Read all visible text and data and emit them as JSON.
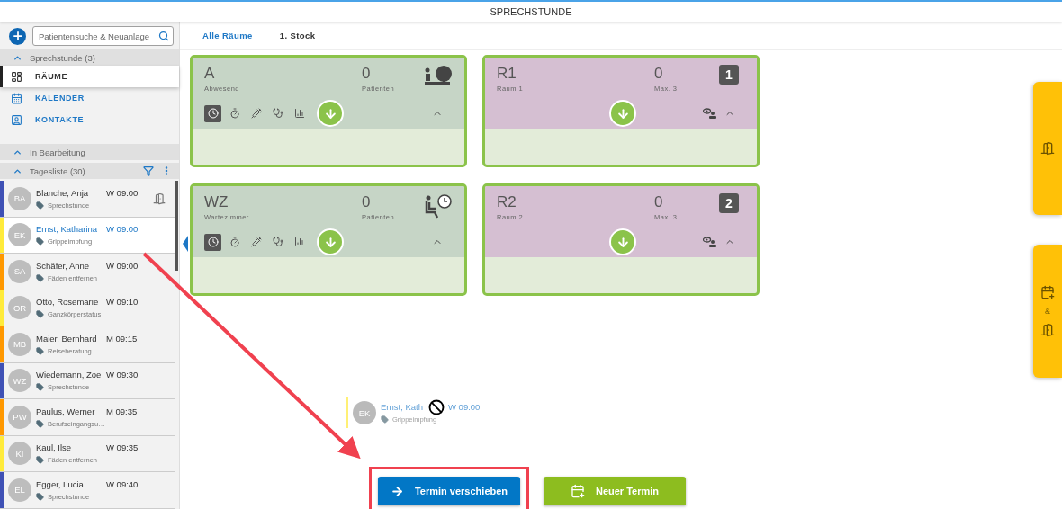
{
  "header": {
    "title": "SPRECHSTUNDE"
  },
  "sidebar": {
    "search": {
      "placeholder": "Patientensuche & Neuanlage"
    },
    "practice": {
      "title": "Sprechstunde (3)",
      "expanded": true,
      "items": [
        {
          "label": "RÄUME",
          "kind": "rooms",
          "selected": true
        },
        {
          "label": "KALENDER",
          "kind": "calendar",
          "selected": false
        },
        {
          "label": "KONTAKTE",
          "kind": "contacts",
          "selected": false
        }
      ]
    },
    "in_progress": {
      "title": "In Bearbeitung",
      "expanded": true
    },
    "day_list": {
      "title": "Tagesliste (30)",
      "expanded": true,
      "patients": [
        {
          "initials": "BA",
          "name": "Blanche, Anja",
          "time": "W 09:00",
          "reason": "Sprechstunde",
          "color": "#3f51b5",
          "selected": false,
          "checked_in": true
        },
        {
          "initials": "EK",
          "name": "Ernst, Katharina",
          "time": "W 09:00",
          "reason": "Grippeimpfung",
          "color": "#ffeb3b",
          "selected": true,
          "checked_in": false
        },
        {
          "initials": "SA",
          "name": "Schäfer, Anne",
          "time": "W 09:00",
          "reason": "Fäden entfernen",
          "color": "#ff9800",
          "selected": false,
          "checked_in": false
        },
        {
          "initials": "OR",
          "name": "Otto, Rosemarie",
          "time": "W 09:10",
          "reason": "Ganzkörperstatus",
          "color": "#ffeb3b",
          "selected": false,
          "checked_in": false
        },
        {
          "initials": "MB",
          "name": "Maier, Bernhard",
          "time": "M 09:15",
          "reason": "Reiseberatung",
          "color": "#ff9800",
          "selected": false,
          "checked_in": false
        },
        {
          "initials": "WZ",
          "name": "Wiedemann, Zoe",
          "time": "W 09:30",
          "reason": "Sprechstunde",
          "color": "#3f51b5",
          "selected": false,
          "checked_in": false
        },
        {
          "initials": "PW",
          "name": "Paulus, Werner",
          "time": "M 09:35",
          "reason": "Berufseingangsu…",
          "color": "#ff9800",
          "selected": false,
          "checked_in": false
        },
        {
          "initials": "KI",
          "name": "Kaul, Ilse",
          "time": "W 09:35",
          "reason": "Fäden entfernen",
          "color": "#ffeb3b",
          "selected": false,
          "checked_in": false
        },
        {
          "initials": "EL",
          "name": "Egger, Lucia",
          "time": "W 09:40",
          "reason": "Sprechstunde",
          "color": "#3f51b5",
          "selected": false,
          "checked_in": false
        }
      ]
    }
  },
  "tabs": [
    {
      "label": "Alle Räume",
      "selected": true
    },
    {
      "label": "1. Stock",
      "selected": false
    }
  ],
  "rooms": [
    {
      "kind": "absent",
      "name": "A",
      "subtitle": "Abwesend",
      "count": "0",
      "count_label": "Patienten",
      "expanded": true,
      "tools": [
        {
          "kind": "clock",
          "selected": true
        },
        {
          "kind": "timer",
          "selected": false
        },
        {
          "kind": "syringe",
          "selected": false
        },
        {
          "kind": "stethoscope",
          "selected": false
        },
        {
          "kind": "chart",
          "selected": false
        }
      ]
    },
    {
      "kind": "room",
      "name": "R1",
      "subtitle": "Raum 1",
      "count": "0",
      "count_label": "Max. 3",
      "badge": "1",
      "expanded": true
    },
    {
      "kind": "waiting",
      "name": "WZ",
      "subtitle": "Wartezimmer",
      "count": "0",
      "count_label": "Patienten",
      "expanded": true,
      "tools": [
        {
          "kind": "clock",
          "selected": true
        },
        {
          "kind": "timer",
          "selected": false
        },
        {
          "kind": "syringe",
          "selected": false
        },
        {
          "kind": "stethoscope",
          "selected": false
        },
        {
          "kind": "chart",
          "selected": false
        }
      ]
    },
    {
      "kind": "room",
      "name": "R2",
      "subtitle": "Raum 2",
      "count": "0",
      "count_label": "Max. 3",
      "badge": "2",
      "expanded": true
    }
  ],
  "drag_preview": {
    "initials": "EK",
    "name": "Ernst, Kath",
    "time": "W 09:00",
    "reason": "Grippeimpfung"
  },
  "actions": [
    {
      "label": "Termin verschieben",
      "kind": "move",
      "highlighted": true
    },
    {
      "label": "Neuer Termin",
      "kind": "new",
      "highlighted": false
    }
  ],
  "side_tabs": [
    {
      "kind": "checkout"
    },
    {
      "kind": "appointment_checkout",
      "joiner": "&"
    }
  ]
}
